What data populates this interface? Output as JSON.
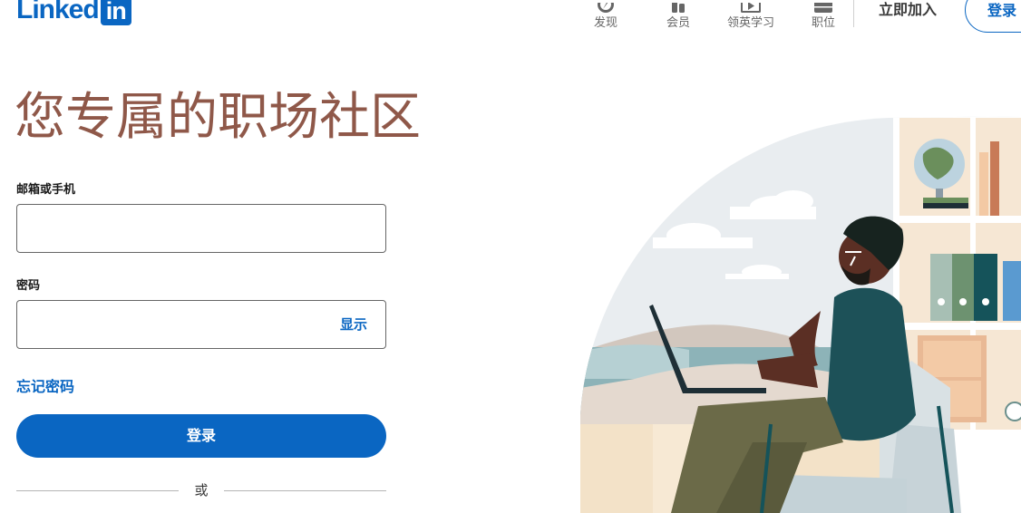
{
  "header": {
    "logo_text": "Linked",
    "logo_box": "in",
    "nav": [
      {
        "label": "发现",
        "icon": "compass-icon"
      },
      {
        "label": "会员",
        "icon": "people-icon"
      },
      {
        "label": "领英学习",
        "icon": "play-video-icon"
      },
      {
        "label": "职位",
        "icon": "briefcase-icon"
      }
    ],
    "join_label": "立即加入",
    "signin_label": "登录"
  },
  "main": {
    "headline": "您专属的职场社区",
    "email_label": "邮箱或手机",
    "email_value": "",
    "password_label": "密码",
    "password_value": "",
    "show_label": "显示",
    "forgot_label": "忘记密码",
    "signin_label": "登录",
    "or_label": "或"
  },
  "colors": {
    "brand_blue": "#0a66c2",
    "headline_brown": "#8f5849"
  }
}
